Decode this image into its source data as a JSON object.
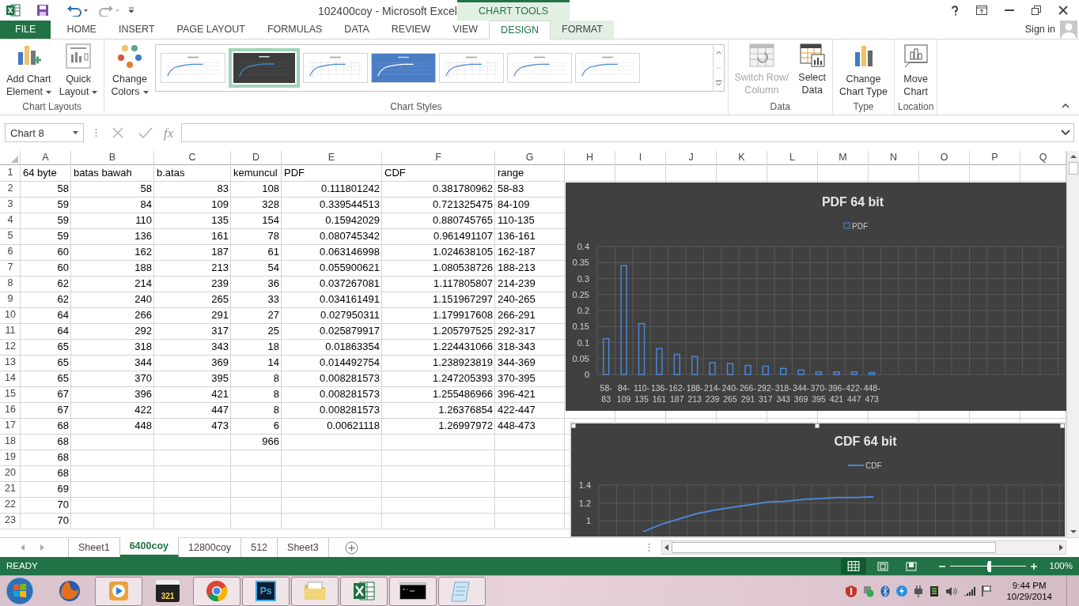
{
  "window": {
    "title": "102400coy - Microsoft Excel",
    "contextual_header": "CHART TOOLS",
    "sign_in": "Sign in"
  },
  "tabs": [
    {
      "label": "FILE",
      "kind": "file",
      "selected": false
    },
    {
      "label": "HOME",
      "kind": "normal",
      "selected": false
    },
    {
      "label": "INSERT",
      "kind": "normal",
      "selected": false
    },
    {
      "label": "PAGE LAYOUT",
      "kind": "normal",
      "selected": false
    },
    {
      "label": "FORMULAS",
      "kind": "normal",
      "selected": false
    },
    {
      "label": "DATA",
      "kind": "normal",
      "selected": false
    },
    {
      "label": "REVIEW",
      "kind": "normal",
      "selected": false
    },
    {
      "label": "VIEW",
      "kind": "normal",
      "selected": false
    },
    {
      "label": "DESIGN",
      "kind": "contextual",
      "selected": true
    },
    {
      "label": "FORMAT",
      "kind": "contextual",
      "selected": false
    }
  ],
  "ribbon": {
    "chart_layouts": {
      "label": "Chart Layouts",
      "buttons": [
        {
          "lines": [
            "Add Chart",
            "Element"
          ]
        },
        {
          "lines": [
            "Quick",
            "Layout"
          ]
        }
      ]
    },
    "change_colors": {
      "lines": [
        "Change",
        "Colors"
      ]
    },
    "chart_styles": {
      "label": "Chart Styles",
      "styles": [
        {
          "kind": "light",
          "selected": false
        },
        {
          "kind": "dark",
          "selected": true
        },
        {
          "kind": "grid",
          "selected": false
        },
        {
          "kind": "blue",
          "selected": false
        },
        {
          "kind": "grid",
          "selected": false
        },
        {
          "kind": "light",
          "selected": false
        },
        {
          "kind": "light",
          "selected": false
        }
      ]
    },
    "data": {
      "label": "Data",
      "buttons": [
        {
          "lines": [
            "Switch Row/",
            "Column"
          ],
          "disabled": true
        },
        {
          "lines": [
            "Select",
            "Data"
          ],
          "disabled": false
        }
      ]
    },
    "type": {
      "label": "Type",
      "lines": [
        "Change",
        "Chart Type"
      ]
    },
    "location": {
      "label": "Location",
      "lines": [
        "Move",
        "Chart"
      ]
    }
  },
  "formula_bar": {
    "name_box": "Chart 8",
    "function_label": "fx"
  },
  "sheet": {
    "columns": [
      {
        "label": "A"
      },
      {
        "label": "B"
      },
      {
        "label": "C"
      },
      {
        "label": "D"
      },
      {
        "label": "E"
      },
      {
        "label": "F"
      },
      {
        "label": "G"
      },
      {
        "label": "H"
      },
      {
        "label": "I"
      },
      {
        "label": "J"
      },
      {
        "label": "K"
      },
      {
        "label": "L"
      },
      {
        "label": "M"
      },
      {
        "label": "N"
      },
      {
        "label": "O"
      },
      {
        "label": "P"
      },
      {
        "label": "Q"
      }
    ],
    "rows": [
      {
        "number": "1",
        "kind": "text",
        "cells": [
          "64 byte",
          "batas bawah",
          "b.atas",
          "kemuncul",
          "PDF",
          "CDF",
          "range"
        ]
      },
      {
        "number": "2",
        "kind": "data",
        "cells": [
          "58",
          "58",
          "83",
          "108",
          "0.111801242",
          "0.381780962",
          "58-83"
        ]
      },
      {
        "number": "3",
        "kind": "data",
        "cells": [
          "59",
          "84",
          "109",
          "328",
          "0.339544513",
          "0.721325475",
          "84-109"
        ]
      },
      {
        "number": "4",
        "kind": "data",
        "cells": [
          "59",
          "110",
          "135",
          "154",
          "0.15942029",
          "0.880745765",
          "110-135"
        ]
      },
      {
        "number": "5",
        "kind": "data",
        "cells": [
          "59",
          "136",
          "161",
          "78",
          "0.080745342",
          "0.961491107",
          "136-161"
        ]
      },
      {
        "number": "6",
        "kind": "data",
        "cells": [
          "60",
          "162",
          "187",
          "61",
          "0.063146998",
          "1.024638105",
          "162-187"
        ]
      },
      {
        "number": "7",
        "kind": "data",
        "cells": [
          "60",
          "188",
          "213",
          "54",
          "0.055900621",
          "1.080538726",
          "188-213"
        ]
      },
      {
        "number": "8",
        "kind": "data",
        "cells": [
          "62",
          "214",
          "239",
          "36",
          "0.037267081",
          "1.117805807",
          "214-239"
        ]
      },
      {
        "number": "9",
        "kind": "data",
        "cells": [
          "62",
          "240",
          "265",
          "33",
          "0.034161491",
          "1.151967297",
          "240-265"
        ]
      },
      {
        "number": "10",
        "kind": "data",
        "cells": [
          "64",
          "266",
          "291",
          "27",
          "0.027950311",
          "1.179917608",
          "266-291"
        ]
      },
      {
        "number": "11",
        "kind": "data",
        "cells": [
          "64",
          "292",
          "317",
          "25",
          "0.025879917",
          "1.205797525",
          "292-317"
        ]
      },
      {
        "number": "12",
        "kind": "data",
        "cells": [
          "65",
          "318",
          "343",
          "18",
          "0.01863354",
          "1.224431066",
          "318-343"
        ]
      },
      {
        "number": "13",
        "kind": "data",
        "cells": [
          "65",
          "344",
          "369",
          "14",
          "0.014492754",
          "1.238923819",
          "344-369"
        ]
      },
      {
        "number": "14",
        "kind": "data",
        "cells": [
          "65",
          "370",
          "395",
          "8",
          "0.008281573",
          "1.247205393",
          "370-395"
        ]
      },
      {
        "number": "15",
        "kind": "data",
        "cells": [
          "67",
          "396",
          "421",
          "8",
          "0.008281573",
          "1.255486966",
          "396-421"
        ]
      },
      {
        "number": "16",
        "kind": "data",
        "cells": [
          "67",
          "422",
          "447",
          "8",
          "0.008281573",
          "1.26376854",
          "422-447"
        ]
      },
      {
        "number": "17",
        "kind": "data",
        "cells": [
          "68",
          "448",
          "473",
          "6",
          "0.00621118",
          "1.26997972",
          "448-473"
        ]
      },
      {
        "number": "18",
        "kind": "data",
        "cells": [
          "68",
          null,
          null,
          "966"
        ]
      },
      {
        "number": "19",
        "kind": "data",
        "cells": [
          "68"
        ]
      },
      {
        "number": "20",
        "kind": "data",
        "cells": [
          "68"
        ]
      },
      {
        "number": "21",
        "kind": "data",
        "cells": [
          "69"
        ]
      },
      {
        "number": "22",
        "kind": "data",
        "cells": [
          "70"
        ]
      },
      {
        "number": "23",
        "kind": "data",
        "cells": [
          "70"
        ]
      }
    ]
  },
  "charts": [
    {
      "selected": false,
      "chart_data": {
        "type": "bar",
        "title": "PDF 64 bit",
        "categories": [
          "58-83",
          "84-109",
          "110-135",
          "136-161",
          "162-187",
          "188-213",
          "214-239",
          "240-265",
          "266-291",
          "292-317",
          "318-343",
          "344-369",
          "370-395",
          "396-421",
          "422-447",
          "448-473"
        ],
        "series": [
          {
            "name": "PDF",
            "color": "#4a86d4",
            "values": [
              0.112,
              0.34,
              0.159,
              0.081,
              0.063,
              0.056,
              0.037,
              0.034,
              0.028,
              0.026,
              0.019,
              0.014,
              0.008,
              0.008,
              0.008,
              0.006
            ]
          }
        ],
        "ylim": [
          0,
          0.4
        ],
        "yticks": [
          0,
          0.05,
          0.1,
          0.15,
          0.2,
          0.25,
          0.3,
          0.35,
          0.4
        ],
        "grid": true
      }
    },
    {
      "selected": true,
      "chart_data": {
        "type": "line",
        "title": "CDF 64 bit",
        "series": [
          {
            "name": "CDF",
            "color": "#4a86d4",
            "values": [
              null,
              null,
              0.88,
              0.96,
              1.02,
              1.08,
              1.12,
              1.15,
              1.18,
              1.21,
              1.22,
              1.24,
              1.25,
              1.26,
              1.26,
              1.27
            ]
          }
        ],
        "ylim": [
          0.8,
          1.4
        ],
        "yticks": [
          1,
          1.2,
          1.4
        ],
        "grid": true
      }
    }
  ],
  "sheet_tabs": [
    {
      "label": "Sheet1",
      "selected": false
    },
    {
      "label": "6400coy",
      "selected": true
    },
    {
      "label": "12800coy",
      "selected": false
    },
    {
      "label": "512",
      "selected": false
    },
    {
      "label": "Sheet3",
      "selected": false
    }
  ],
  "status_bar": {
    "status": "READY",
    "zoom": {
      "level": 0.53,
      "reading": "100%"
    }
  },
  "taskbar": {
    "apps": [
      {
        "kind": "firefox",
        "open": false
      },
      {
        "kind": "media",
        "open": true
      },
      {
        "kind": "player",
        "label": "321",
        "open": false
      },
      {
        "kind": "chrome",
        "open": true
      },
      {
        "kind": "photoshop",
        "label": "Ps",
        "open": true
      },
      {
        "kind": "explorer",
        "open": true
      },
      {
        "kind": "excel",
        "open": true
      },
      {
        "kind": "console",
        "open": true
      },
      {
        "kind": "notepad",
        "open": true
      }
    ],
    "time": "9:44 PM",
    "date": "10/29/2014"
  }
}
